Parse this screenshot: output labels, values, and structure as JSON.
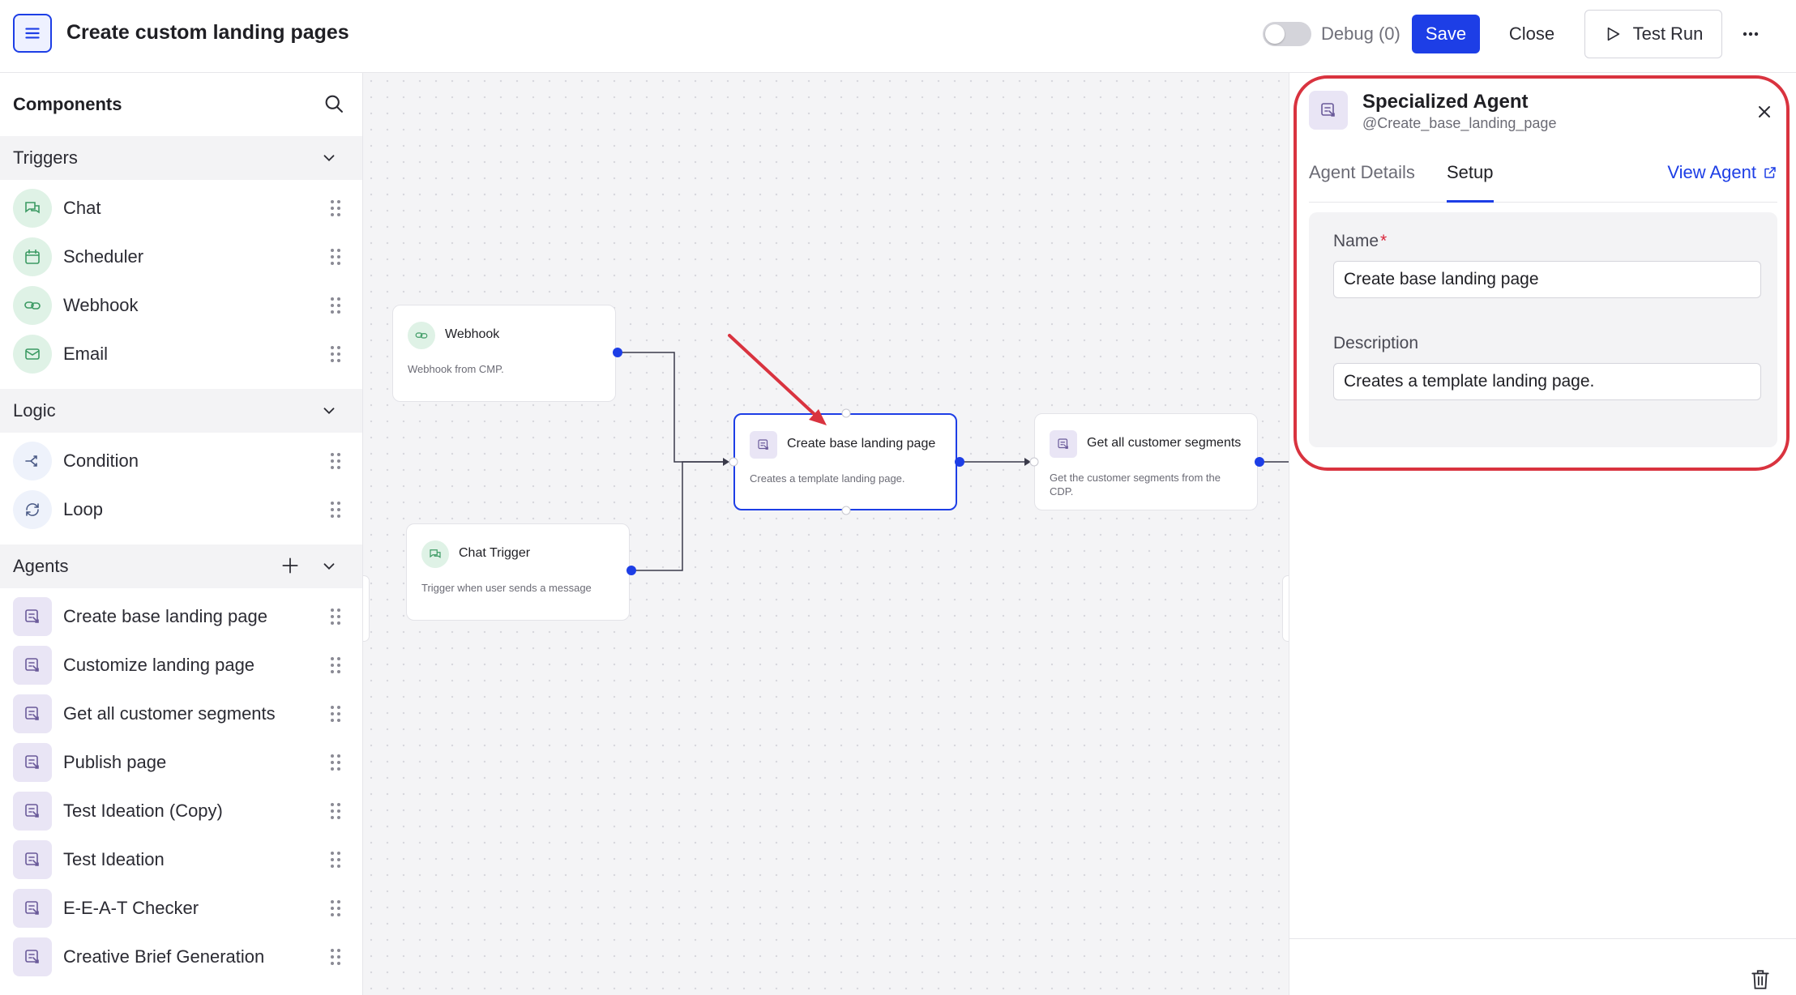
{
  "header": {
    "title": "Create custom landing pages",
    "debug_label": "Debug (0)",
    "save_label": "Save",
    "close_label": "Close",
    "test_run_label": "Test Run",
    "more_label": "•••"
  },
  "components": {
    "title": "Components",
    "triggers": {
      "label": "Triggers",
      "items": [
        {
          "label": "Chat",
          "icon": "chat-icon"
        },
        {
          "label": "Scheduler",
          "icon": "calendar-icon"
        },
        {
          "label": "Webhook",
          "icon": "link-icon"
        },
        {
          "label": "Email",
          "icon": "mail-icon"
        }
      ]
    },
    "logic": {
      "label": "Logic",
      "items": [
        {
          "label": "Condition",
          "icon": "branch-icon"
        },
        {
          "label": "Loop",
          "icon": "loop-icon"
        }
      ]
    },
    "agents": {
      "label": "Agents",
      "items": [
        {
          "label": "Create base landing page"
        },
        {
          "label": "Customize landing page"
        },
        {
          "label": "Get all customer segments"
        },
        {
          "label": "Publish page"
        },
        {
          "label": "Test Ideation (Copy)"
        },
        {
          "label": "Test Ideation"
        },
        {
          "label": "E-E-A-T Checker"
        },
        {
          "label": "Creative Brief Generation"
        }
      ]
    }
  },
  "canvas": {
    "nodes": [
      {
        "title": "Webhook",
        "desc": "Webhook from CMP."
      },
      {
        "title": "Chat Trigger",
        "desc": "Trigger when user sends a message"
      },
      {
        "title": "Create base landing page",
        "desc": "Creates a template landing page."
      },
      {
        "title": "Get all customer segments",
        "desc": "Get the customer segments from the CDP."
      }
    ]
  },
  "detail": {
    "title": "Specialized Agent",
    "handle": "@Create_base_landing_page",
    "tabs": [
      "Agent Details",
      "Setup"
    ],
    "active_tab": "Setup",
    "view_agent_label": "View Agent",
    "name_label": "Name",
    "required_mark": "*",
    "name_value": "Create base landing page",
    "description_label": "Description",
    "description_value": "Creates a template landing page."
  },
  "colors": {
    "accent": "#1d3ee6",
    "trigger_bg": "#dff2e6",
    "agent_bg": "#e9e5f5",
    "annotation": "#d9333f"
  }
}
